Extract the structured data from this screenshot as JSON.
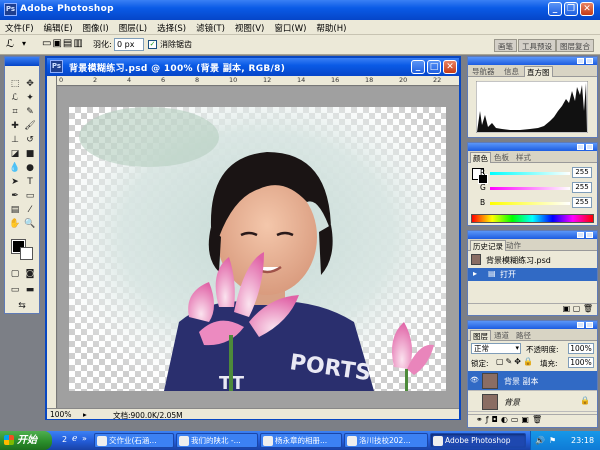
{
  "app": {
    "title": "Adobe Photoshop",
    "logo_text": "Ps"
  },
  "menu": [
    "文件(F)",
    "编辑(E)",
    "图像(I)",
    "图层(L)",
    "选择(S)",
    "滤镜(T)",
    "视图(V)",
    "窗口(W)",
    "帮助(H)"
  ],
  "options": {
    "feather_label": "羽化:",
    "feather_value": "0 px",
    "antialias_label": "消除锯齿",
    "antialias_checked": true,
    "well_tabs": [
      "画笔",
      "工具预设",
      "图层复合"
    ]
  },
  "document": {
    "title": "背景模糊练习.psd @ 100% (背景 副本, RGB/8)",
    "ruler_ticks": [
      "0",
      "2",
      "4",
      "6",
      "8",
      "10",
      "12",
      "14",
      "16",
      "18",
      "20",
      "22"
    ],
    "zoom": "100%",
    "doc_size": "文档:900.0K/2.05M"
  },
  "navigator_panel": {
    "tabs": [
      "导航器",
      "信息",
      "直方图"
    ],
    "active_tab": "直方图"
  },
  "color_panel": {
    "tabs": [
      "颜色",
      "色板",
      "样式"
    ],
    "active_tab": "颜色",
    "channels": [
      {
        "label": "R",
        "value": "255",
        "color": "#e03030"
      },
      {
        "label": "G",
        "value": "255",
        "color": "#30c030"
      },
      {
        "label": "B",
        "value": "255",
        "color": "#3050e0"
      }
    ]
  },
  "history_panel": {
    "tabs": [
      "历史记录",
      "动作"
    ],
    "active_tab": "历史记录",
    "snapshot_label": "背景模糊练习.psd",
    "items": [
      "打开"
    ]
  },
  "layers_panel": {
    "tabs": [
      "图层",
      "通道",
      "路径"
    ],
    "active_tab": "图层",
    "blend_mode": "正常",
    "opacity_label": "不透明度:",
    "opacity_value": "100%",
    "lock_label": "锁定:",
    "fill_label": "填充:",
    "fill_value": "100%",
    "layers": [
      {
        "name": "背景 副本",
        "selected": true,
        "visible": true
      },
      {
        "name": "背景",
        "selected": false,
        "visible": false
      }
    ]
  },
  "taskbar": {
    "start_label": "开始",
    "quicklaunch_count": "2",
    "tasks": [
      {
        "label": "交作业(石涵...",
        "active": false
      },
      {
        "label": "我们的陕北 -...",
        "active": false
      },
      {
        "label": "杨永章的相册...",
        "active": false
      },
      {
        "label": "洛川技校202...",
        "active": false
      },
      {
        "label": "Adobe Photoshop",
        "active": true
      }
    ],
    "clock": "23:18"
  },
  "colors": {
    "xp_blue": "#0a5be6",
    "selection": "#316ac5",
    "panel_bg": "#ece9d8",
    "start_green": "#2c8f2c"
  }
}
